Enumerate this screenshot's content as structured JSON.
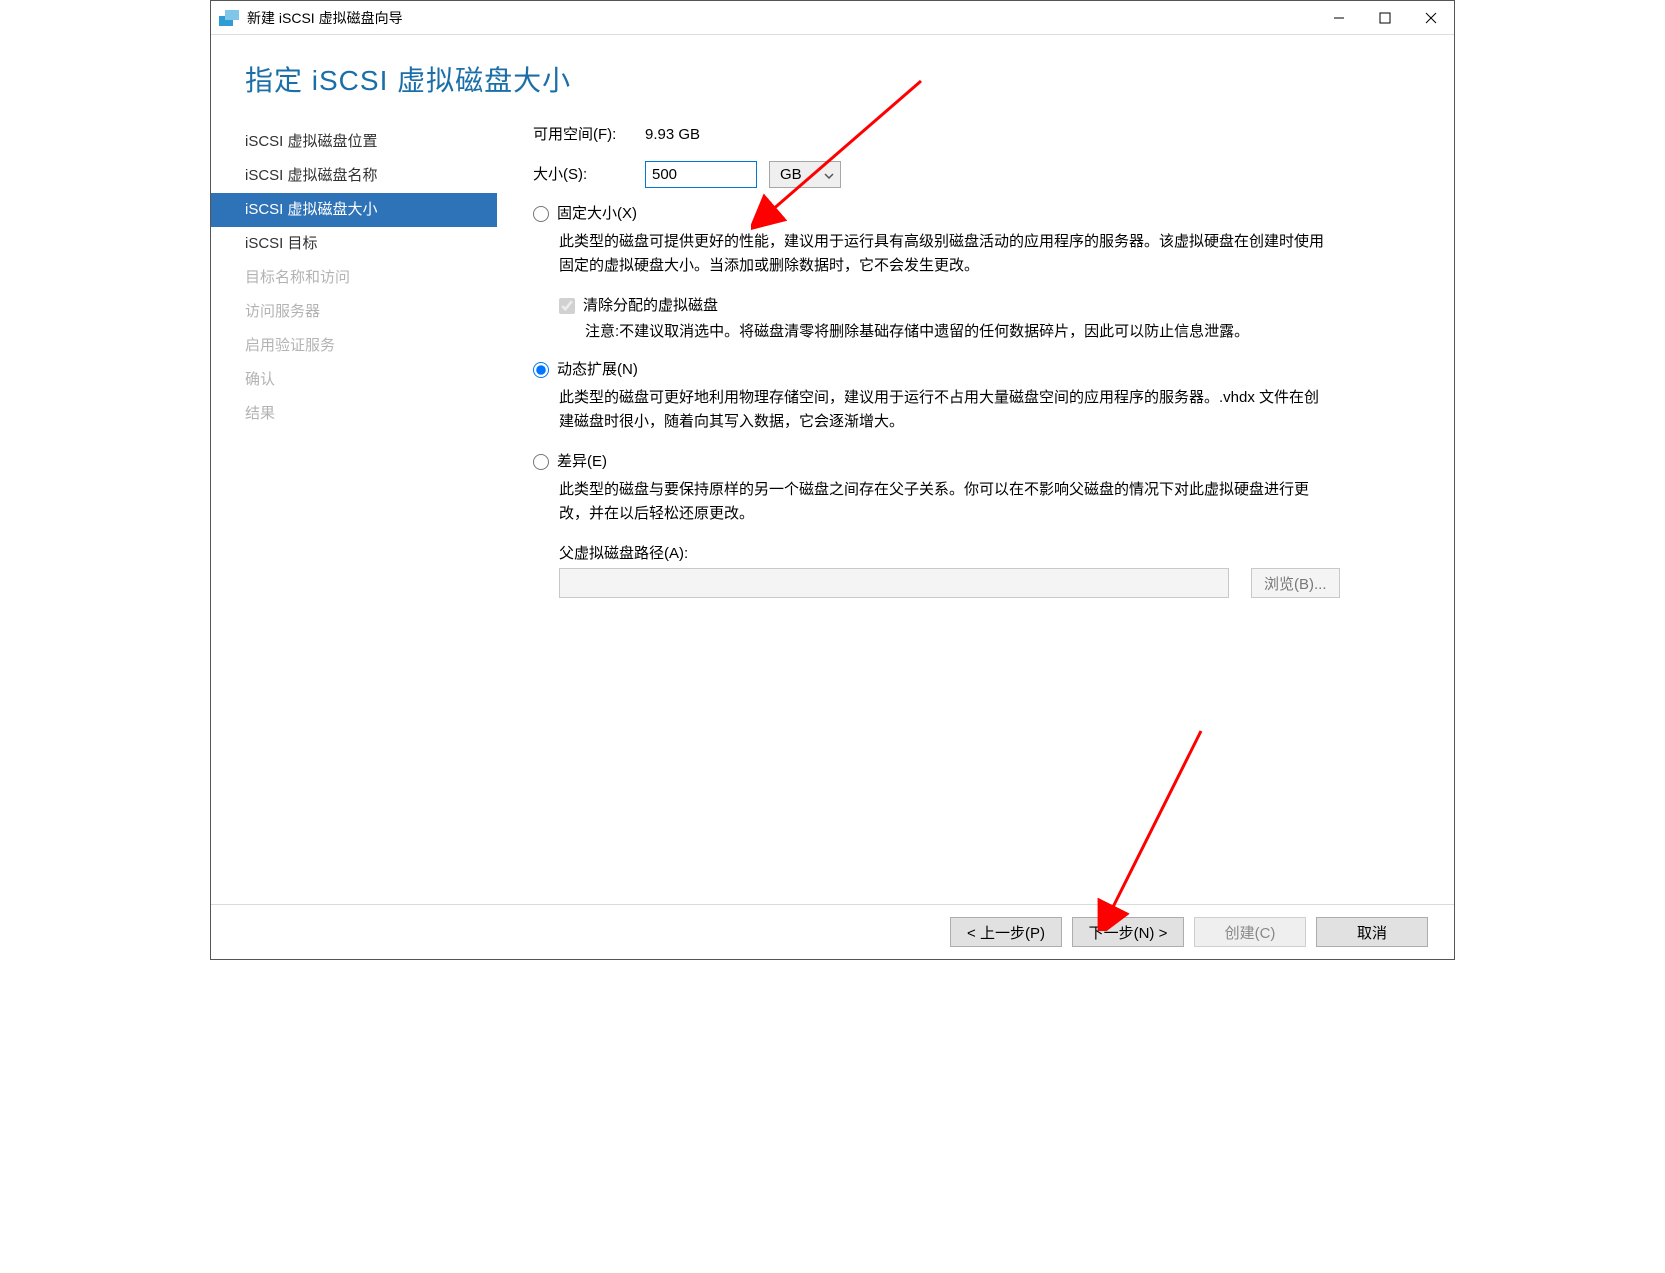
{
  "window": {
    "title": "新建 iSCSI 虚拟磁盘向导"
  },
  "header": {
    "title": "指定 iSCSI 虚拟磁盘大小"
  },
  "sidebar": {
    "items": [
      {
        "label": "iSCSI 虚拟磁盘位置",
        "state": "normal"
      },
      {
        "label": "iSCSI 虚拟磁盘名称",
        "state": "normal"
      },
      {
        "label": "iSCSI 虚拟磁盘大小",
        "state": "active"
      },
      {
        "label": "iSCSI 目标",
        "state": "normal"
      },
      {
        "label": "目标名称和访问",
        "state": "disabled"
      },
      {
        "label": "访问服务器",
        "state": "disabled"
      },
      {
        "label": "启用验证服务",
        "state": "disabled"
      },
      {
        "label": "确认",
        "state": "disabled"
      },
      {
        "label": "结果",
        "state": "disabled"
      }
    ]
  },
  "content": {
    "free_label": "可用空间(F):",
    "free_value": "9.93 GB",
    "size_label": "大小(S):",
    "size_value": "500",
    "unit_value": "GB",
    "fixed": {
      "label": "固定大小(X)",
      "desc": "此类型的磁盘可提供更好的性能，建议用于运行具有高级别磁盘活动的应用程序的服务器。该虚拟硬盘在创建时使用固定的虚拟硬盘大小。当添加或删除数据时，它不会发生更改。",
      "clear_label": "清除分配的虚拟磁盘",
      "clear_note": "注意:不建议取消选中。将磁盘清零将删除基础存储中遗留的任何数据碎片，因此可以防止信息泄露。"
    },
    "dynamic": {
      "label": "动态扩展(N)",
      "desc": "此类型的磁盘可更好地利用物理存储空间，建议用于运行不占用大量磁盘空间的应用程序的服务器。.vhdx 文件在创建磁盘时很小，随着向其写入数据，它会逐渐增大。"
    },
    "diff": {
      "label": "差异(E)",
      "desc": "此类型的磁盘与要保持原样的另一个磁盘之间存在父子关系。你可以在不影响父磁盘的情况下对此虚拟硬盘进行更改，并在以后轻松还原更改。",
      "parent_label": "父虚拟磁盘路径(A):",
      "browse": "浏览(B)..."
    }
  },
  "footer": {
    "prev": "< 上一步(P)",
    "next": "下一步(N) >",
    "create": "创建(C)",
    "cancel": "取消"
  }
}
